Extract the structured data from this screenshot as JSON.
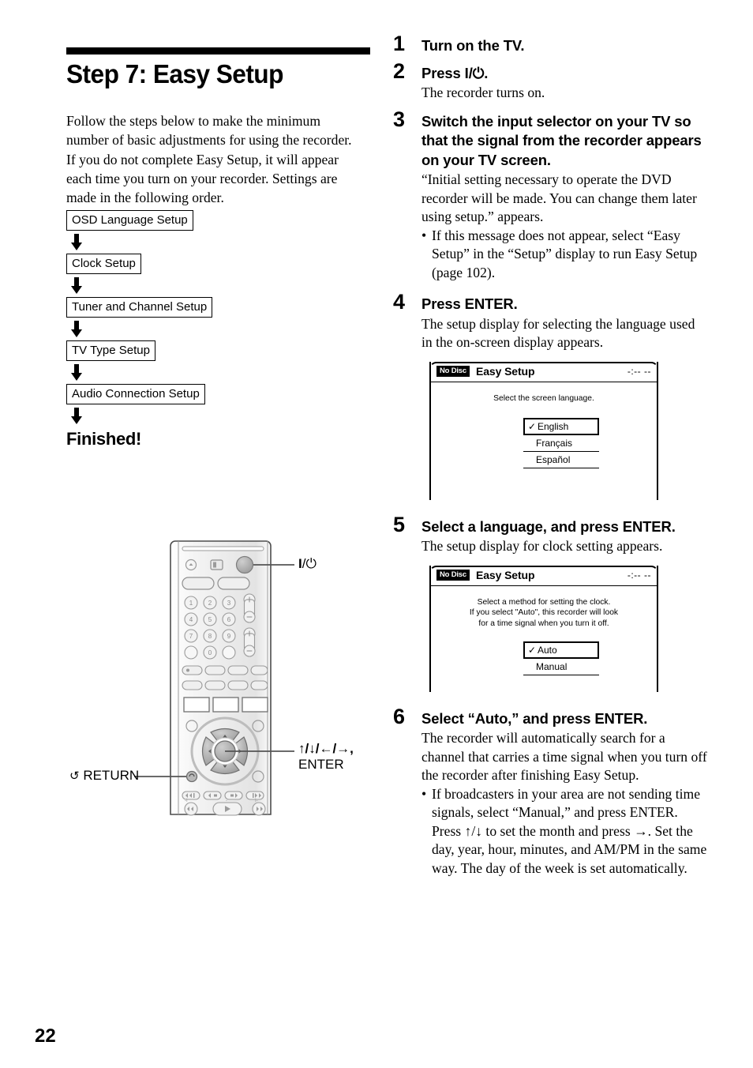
{
  "page": {
    "number": "22",
    "title": "Step 7: Easy Setup"
  },
  "left_column": {
    "intro": "Follow the steps below to make the minimum number of basic adjustments for using the recorder. If you do not complete Easy Setup, it will appear each time you turn on your recorder. Settings are made in the following order.",
    "flow_steps": [
      "OSD Language Setup",
      "Clock Setup",
      "Tuner and Channel Setup",
      "TV Type Setup",
      "Audio Connection Setup"
    ],
    "finished_label": "Finished!"
  },
  "remote": {
    "callout_power": "I/⏻",
    "callout_nav": "↑/↓/←/→,",
    "callout_enter": "ENTER",
    "callout_return": "RETURN",
    "keypad": [
      "1",
      "2",
      "3",
      "4",
      "5",
      "6",
      "7",
      "8",
      "9",
      "0"
    ]
  },
  "steps": [
    {
      "num": "1",
      "head": "Turn on the TV.",
      "body": "",
      "bullets": []
    },
    {
      "num": "2",
      "head": "Press I/⏻.",
      "body": "The recorder turns on.",
      "bullets": []
    },
    {
      "num": "3",
      "head": "Switch the input selector on your TV so that the signal from the recorder appears on your TV screen.",
      "body": "“Initial setting necessary to operate the DVD recorder will be made. You can change them later using setup.” appears.",
      "bullets": [
        "If this message does not appear, select “Easy Setup” in the “Setup” display to run Easy Setup (page 102)."
      ]
    },
    {
      "num": "4",
      "head": "Press ENTER.",
      "body": "The setup display for selecting the language used in the on-screen display appears.",
      "bullets": []
    },
    {
      "num": "5",
      "head": "Select a language, and press ENTER.",
      "body": "The setup display for clock setting appears.",
      "bullets": []
    },
    {
      "num": "6",
      "head": "Select “Auto,” and press ENTER.",
      "body": "The recorder will automatically search for a channel that carries a time signal when you turn off the recorder after finishing Easy Setup.",
      "bullets": [
        "If broadcasters in your area are not sending time signals, select “Manual,” and press ENTER. Press ↑/↓ to set the month and press →. Set the day, year, hour, minutes, and AM/PM in the same way. The day of the week is set automatically."
      ]
    }
  ],
  "osd_screens": [
    {
      "badge": "No Disc",
      "title": "Easy Setup",
      "clock": "-:-- --",
      "message": "Select the screen language.",
      "options": [
        {
          "label": "English",
          "selected": true
        },
        {
          "label": "Français",
          "selected": false
        },
        {
          "label": "Español",
          "selected": false
        }
      ]
    },
    {
      "badge": "No Disc",
      "title": "Easy Setup",
      "clock": "-:-- --",
      "message": "Select a method for setting the clock.\nIf you select \"Auto\", this recorder will look\nfor a time signal when you turn it off.",
      "options": [
        {
          "label": "Auto",
          "selected": true
        },
        {
          "label": "Manual",
          "selected": false
        }
      ]
    }
  ],
  "colors": {
    "ink": "#000000",
    "paper": "#ffffff",
    "remote_body": "#f2f2f2",
    "remote_key": "#b3b3b3"
  }
}
